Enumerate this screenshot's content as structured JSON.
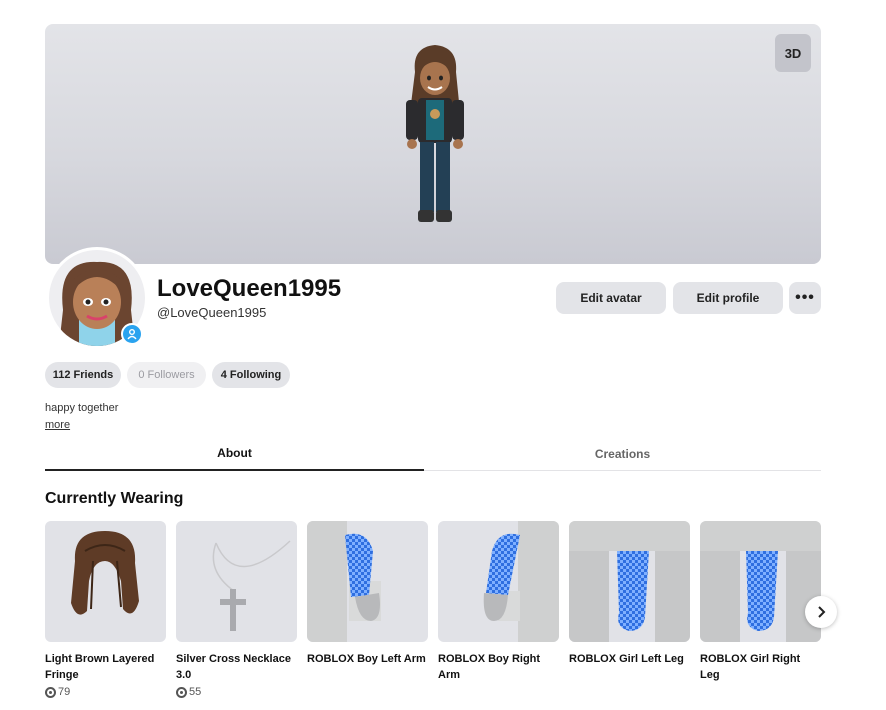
{
  "banner": {
    "mode_button": "3D"
  },
  "profile": {
    "display_name": "LoveQueen1995",
    "username": "@LoveQueen1995",
    "bio": "happy together",
    "more_link": "more"
  },
  "actions": {
    "edit_avatar": "Edit avatar",
    "edit_profile": "Edit profile",
    "more": "•••"
  },
  "social": {
    "friends": "112 Friends",
    "followers": "0 Followers",
    "following": "4 Following"
  },
  "tabs": [
    {
      "label": "About",
      "active": true
    },
    {
      "label": "Creations",
      "active": false
    }
  ],
  "wearing": {
    "title": "Currently Wearing",
    "items": [
      {
        "name": "Light Brown Layered Fringe",
        "price": "79",
        "icon": "hair"
      },
      {
        "name": "Silver Cross Necklace 3.0",
        "price": "55",
        "icon": "necklace"
      },
      {
        "name": "ROBLOX Boy Left Arm",
        "price": "",
        "icon": "left-arm"
      },
      {
        "name": "ROBLOX Boy Right Arm",
        "price": "",
        "icon": "right-arm"
      },
      {
        "name": "ROBLOX Girl Left Leg",
        "price": "",
        "icon": "left-leg"
      },
      {
        "name": "ROBLOX Girl Right Leg",
        "price": "",
        "icon": "right-leg"
      }
    ],
    "next_icon": "chevron-right-icon"
  },
  "colors": {
    "accent_badge": "#2aa3ef",
    "button_bg": "#e3e4e8",
    "limb_blue": "#2f6fe0"
  }
}
